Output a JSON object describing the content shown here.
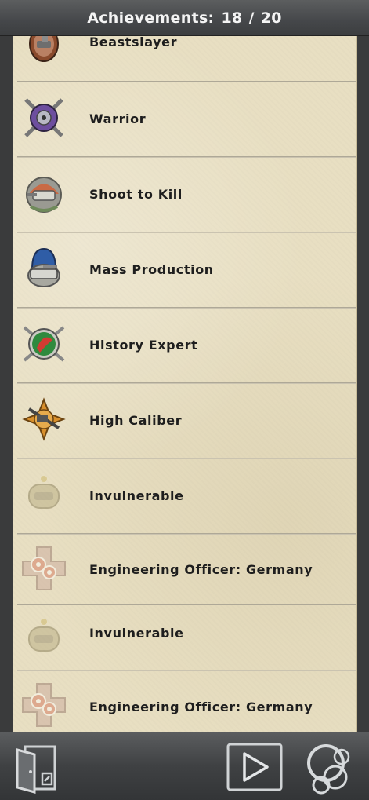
{
  "header": {
    "title": "Achievements:",
    "earned": "18",
    "separator": "/",
    "total": "20"
  },
  "achievements": [
    {
      "label": "Beastslayer",
      "icon": "beastslayer-medal-icon",
      "locked": false
    },
    {
      "label": "Warrior",
      "icon": "warrior-medal-icon",
      "locked": false
    },
    {
      "label": "Shoot to Kill",
      "icon": "shoot-to-kill-medal-icon",
      "locked": false
    },
    {
      "label": "Mass Production",
      "icon": "mass-production-medal-icon",
      "locked": false
    },
    {
      "label": "History Expert",
      "icon": "history-expert-medal-icon",
      "locked": false
    },
    {
      "label": "High Caliber",
      "icon": "high-caliber-medal-icon",
      "locked": false
    },
    {
      "label": "Invulnerable",
      "icon": "invulnerable-medal-icon",
      "locked": true
    },
    {
      "label": "Engineering Officer: Germany",
      "icon": "engineering-officer-medal-icon",
      "locked": true
    },
    {
      "label": "Invulnerable",
      "icon": "invulnerable-medal-icon",
      "locked": true
    },
    {
      "label": "Engineering Officer: Germany",
      "icon": "engineering-officer-medal-icon",
      "locked": true
    }
  ],
  "footer": {
    "exit_icon": "exit-door-icon",
    "play_icon": "play-icon",
    "circles_icon": "overlapping-circles-icon"
  },
  "colors": {
    "parchment": "#e8dfc2",
    "bar": "#45474a",
    "text": "#1e1e1e"
  }
}
